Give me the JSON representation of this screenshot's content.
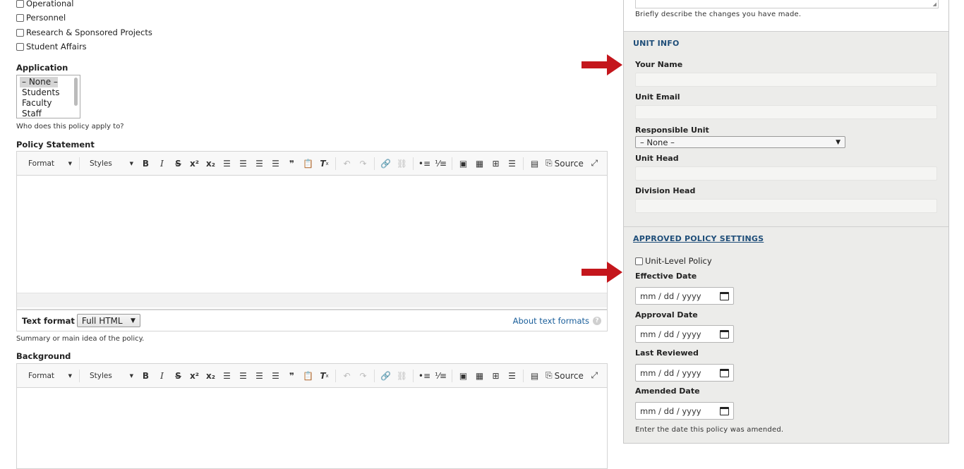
{
  "categories": {
    "items": [
      "Operational",
      "Personnel",
      "Research & Sponsored Projects",
      "Student Affairs"
    ]
  },
  "application": {
    "label": "Application",
    "options": [
      "– None –",
      "Students",
      "Faculty",
      "Staff"
    ],
    "selected": "– None –",
    "help": "Who does this policy apply to?"
  },
  "toolbar": {
    "format_label": "Format",
    "styles_label": "Styles",
    "source_label": "Source"
  },
  "policy_statement": {
    "label": "Policy Statement",
    "text_format_label": "Text format",
    "text_format_value": "Full HTML",
    "about_link": "About text formats",
    "help": "Summary or main idea of the policy."
  },
  "background": {
    "label": "Background"
  },
  "sidebar": {
    "revision_help": "Briefly describe the changes you have made.",
    "unit_info_heading": "UNIT INFO",
    "your_name_label": "Your Name",
    "unit_email_label": "Unit Email",
    "responsible_unit_label": "Responsible Unit",
    "responsible_unit_value": "– None –",
    "unit_head_label": "Unit Head",
    "division_head_label": "Division Head",
    "approved_heading": "APPROVED POLICY SETTINGS",
    "unit_level_label": "Unit-Level Policy",
    "effective_date_label": "Effective Date",
    "approval_date_label": "Approval Date",
    "last_reviewed_label": "Last Reviewed",
    "amended_date_label": "Amended Date",
    "date_placeholder": "mm / dd / yyyy",
    "amended_help": "Enter the date this policy was amended."
  },
  "icons": {
    "arrow_color": "#c4161c"
  }
}
